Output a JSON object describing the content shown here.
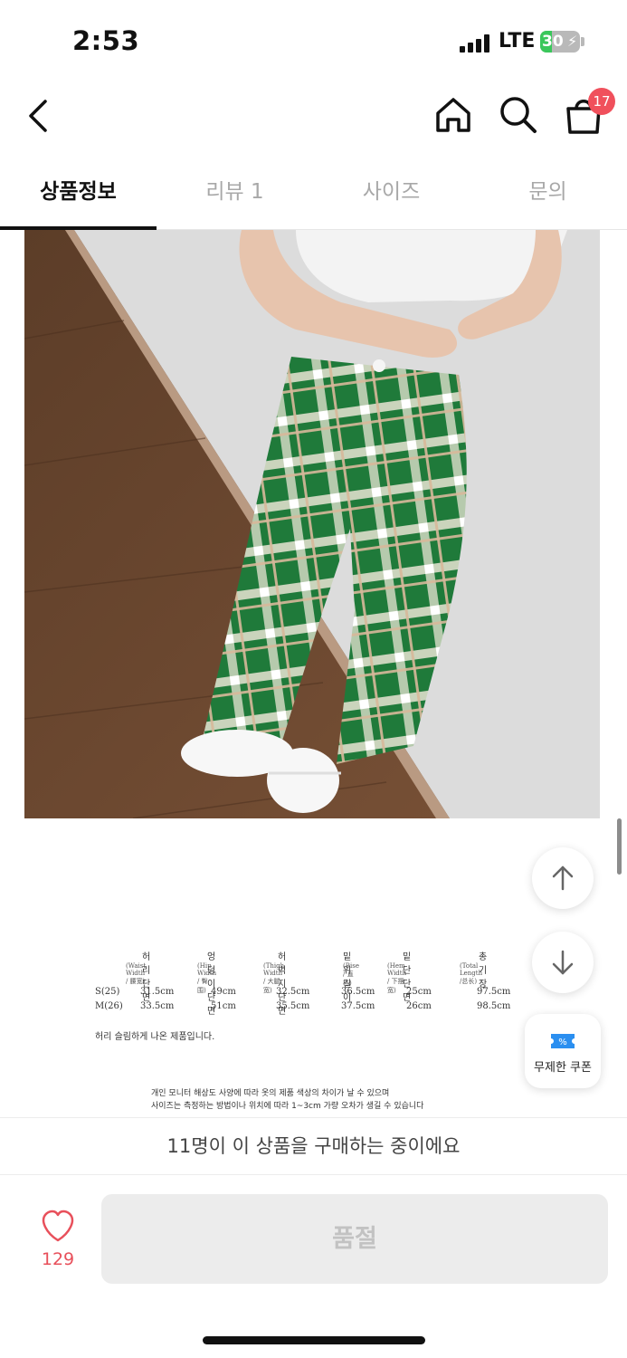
{
  "status_bar": {
    "time": "2:53",
    "network": "LTE",
    "battery": "30",
    "battery_level": 0.3
  },
  "nav": {
    "cart_count": "17"
  },
  "tabs": [
    {
      "label": "상품정보",
      "active": true
    },
    {
      "label": "리뷰 1",
      "active": false
    },
    {
      "label": "사이즈",
      "active": false
    },
    {
      "label": "문의",
      "active": false
    }
  ],
  "size_chart": {
    "headers": [
      {
        "ko": "허리단면",
        "en": "(Waist Width / 腰宽)"
      },
      {
        "ko": "엉덩이단면",
        "en": "(Hip Width / 臀围)"
      },
      {
        "ko": "허벅지단면",
        "en": "(Thigh Width / 大腿宽)"
      },
      {
        "ko": "밑위길이",
        "en": "(Rise / 直档)"
      },
      {
        "ko": "밑단단면",
        "en": "(Hem Width / 下摆宽)"
      },
      {
        "ko": "총기장",
        "en": "(Total Length /总长)"
      }
    ],
    "rows": [
      {
        "size": "S(25)",
        "values": [
          "31.5cm",
          "49cm",
          "32.5cm",
          "36.5cm",
          "25cm",
          "97.5cm"
        ]
      },
      {
        "size": "M(26)",
        "values": [
          "33.5cm",
          "51cm",
          "35.5cm",
          "37.5cm",
          "26cm",
          "98.5cm"
        ]
      }
    ],
    "note": "허리 슬림하게 나온 제품입니다.",
    "disclaimer": [
      "개인 모니터 해상도 사양에 따라 옷의 제품 색상의 차이가 날 수 있으며",
      "사이즈는 측정하는 방법이나 위치에 따라 1~3cm 가량 오차가 생길 수 있습니다"
    ]
  },
  "coupon": {
    "label": "무제한 쿠폰",
    "accent": "#2b8ff0"
  },
  "purchase_banner": "11명이 이 상품을 구매하는 중이에요",
  "bottom": {
    "likes": "129",
    "buy_label": "품절"
  },
  "colors": {
    "accent_red": "#e8505b",
    "badge": "#f0505c",
    "plaid_green": "#1f7a3a"
  }
}
